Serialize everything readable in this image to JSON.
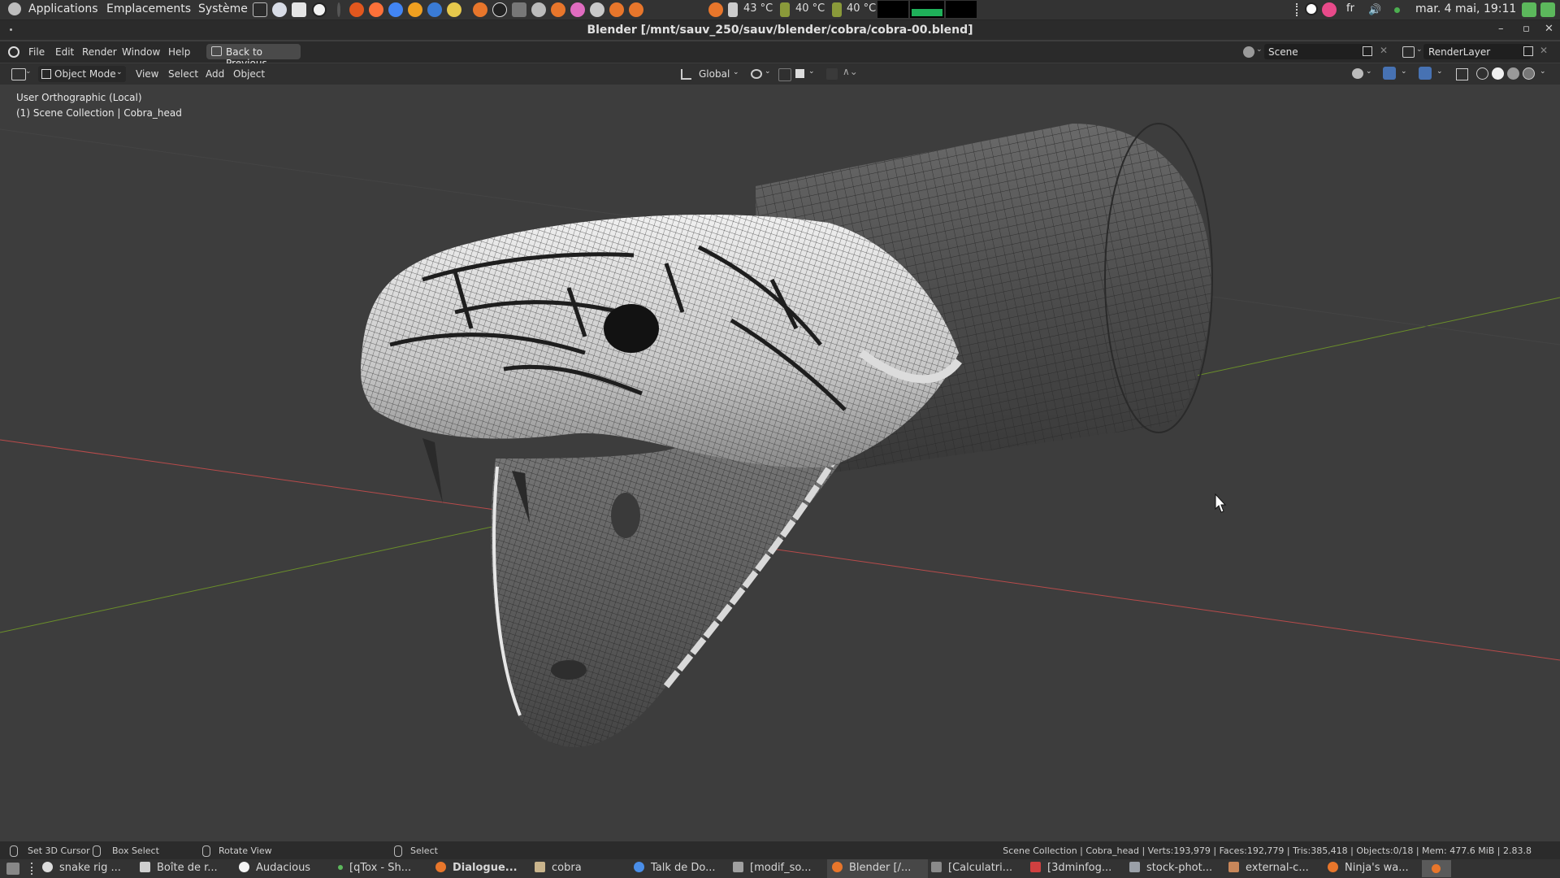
{
  "os_panel": {
    "menus": [
      "Applications",
      "Emplacements",
      "Système"
    ],
    "temps": [
      "43 °C",
      "40 °C",
      "40 °C"
    ],
    "lang": "fr",
    "clock": "mar. 4 mai, 19:11"
  },
  "window": {
    "title": "Blender [/mnt/sauv_250/sauv/blender/cobra/cobra-00.blend]"
  },
  "topbar": {
    "menus": [
      "File",
      "Edit",
      "Render",
      "Window",
      "Help"
    ],
    "back_button": "Back to Previous",
    "scene": "Scene",
    "view_layer": "RenderLayer"
  },
  "header": {
    "mode": "Object Mode",
    "menus": [
      "View",
      "Select",
      "Add",
      "Object"
    ],
    "orientation": "Global"
  },
  "viewport": {
    "view_name": "User Orthographic (Local)",
    "collection": "(1) Scene Collection | Cobra_head"
  },
  "statusbar": {
    "set_cursor": "Set 3D Cursor",
    "box_select": "Box Select",
    "rotate_view": "Rotate View",
    "select": "Select",
    "stats": "Scene Collection | Cobra_head | Verts:193,979 | Faces:192,779 | Tris:385,418 | Objects:0/18 | Mem: 477.6 MiB | 2.83.8"
  },
  "taskbar": {
    "items": [
      {
        "label": "snake rig ...",
        "color": "#dddddd"
      },
      {
        "label": "Boîte de r...",
        "color": "#cfcfcf"
      },
      {
        "label": "Audacious",
        "color": "#f5f5f5"
      },
      {
        "label": "[qTox - Sh...",
        "color": "#5cb85c"
      },
      {
        "label": "Dialogue...",
        "color": "#e8762b"
      },
      {
        "label": "cobra",
        "color": "#c9b48c"
      },
      {
        "label": "Talk de Do...",
        "color": "#4a8ee8"
      },
      {
        "label": "[modif_so...",
        "color": "#a0a0a0"
      },
      {
        "label": "Blender [/...",
        "color": "#e8762b"
      },
      {
        "label": "[Calculatri...",
        "color": "#8a8a8a"
      },
      {
        "label": "[3dminfog...",
        "color": "#d04040"
      },
      {
        "label": "stock-phot...",
        "color": "#9aa0a8"
      },
      {
        "label": "external-c...",
        "color": "#c9875a"
      },
      {
        "label": "Ninja's wa...",
        "color": "#e8762b"
      }
    ]
  },
  "colors": {
    "x_axis": "#b84b4b",
    "y_axis": "#6b8f2a",
    "accent": "#e8762b"
  }
}
